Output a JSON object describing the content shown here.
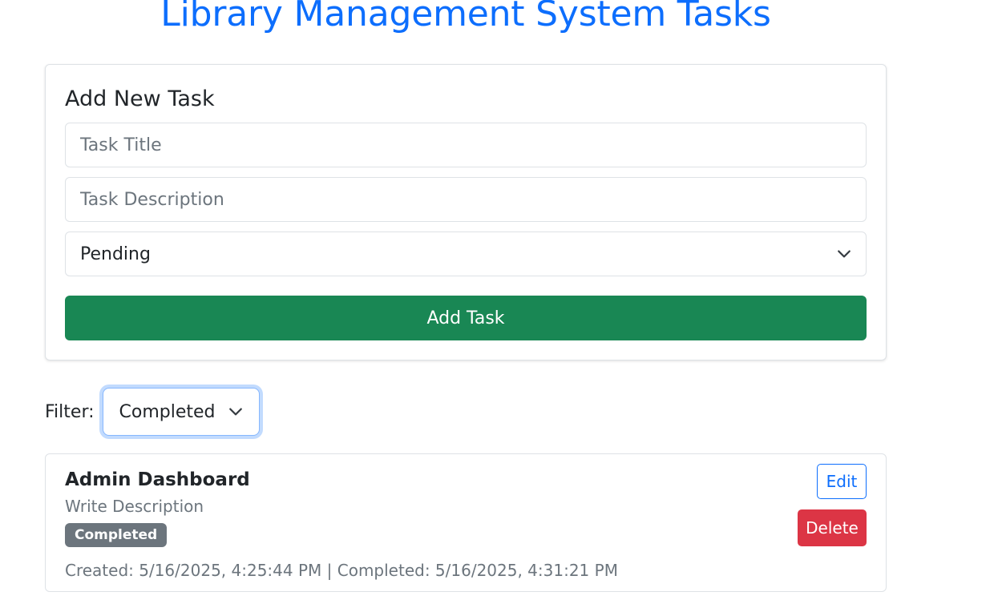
{
  "page": {
    "title": "Library Management System Tasks"
  },
  "add_form": {
    "heading": "Add New Task",
    "title_placeholder": "Task Title",
    "description_placeholder": "Task Description",
    "status_value": "Pending",
    "submit_label": "Add Task"
  },
  "filter": {
    "label": "Filter:",
    "value": "Completed"
  },
  "tasks": [
    {
      "title": "Admin Dashboard",
      "description": "Write Description",
      "status": "Completed",
      "meta": "Created: 5/16/2025, 4:25:44 PM | Completed: 5/16/2025, 4:31:21 PM",
      "edit_label": "Edit",
      "delete_label": "Delete"
    }
  ],
  "icons": {
    "select_caret": "chevron-down-icon"
  },
  "colors": {
    "primary": "#0d6efd",
    "success": "#198754",
    "danger": "#dc3545",
    "secondary": "#6c757d"
  }
}
